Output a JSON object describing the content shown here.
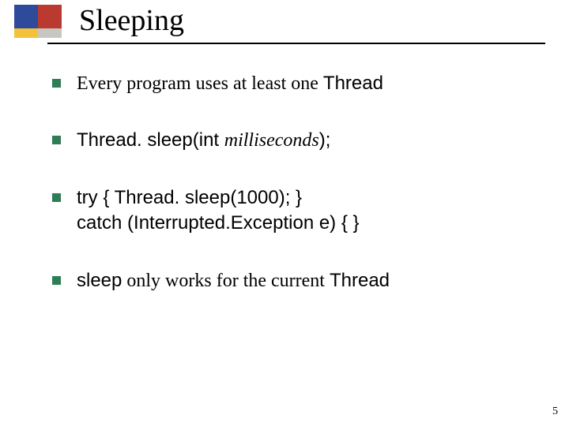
{
  "title": "Sleeping",
  "page_number": "5",
  "bullets": [
    {
      "parts": [
        {
          "text": "Every program uses at least one ",
          "cls": ""
        },
        {
          "text": "Thread",
          "cls": "sans"
        }
      ]
    },
    {
      "parts": [
        {
          "text": "Thread. sleep(int ",
          "cls": "sans"
        },
        {
          "text": "milliseconds",
          "cls": "ital"
        },
        {
          "text": ");",
          "cls": "sans"
        }
      ]
    },
    {
      "parts": [
        {
          "text": "try { Thread. sleep(1000); }",
          "cls": "sans"
        },
        {
          "text": "\n",
          "cls": "br"
        },
        {
          "text": "catch (Interrupted.Exception e) { }",
          "cls": "sans"
        }
      ]
    },
    {
      "parts": [
        {
          "text": "sleep",
          "cls": "sans"
        },
        {
          "text": " only works for the current ",
          "cls": ""
        },
        {
          "text": "Thread",
          "cls": "sans"
        }
      ]
    }
  ]
}
